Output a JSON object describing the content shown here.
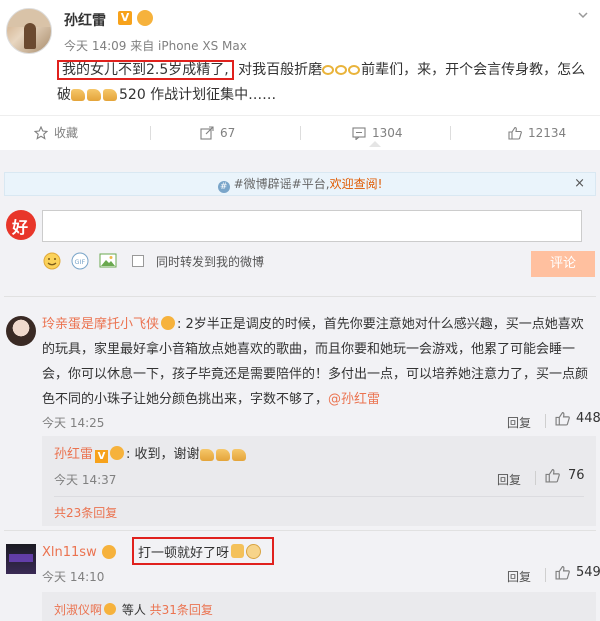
{
  "post": {
    "author": "孙红雷",
    "badge": "V",
    "meta": "今天 14:09 来自 iPhone XS Max",
    "text_highlight": "我的女儿不到2.5岁成精了,",
    "text_part2": " 对我百般折磨",
    "text_part3": "前辈们，来，开个会言传身教，怎么破",
    "text_part4": "520 作战计划征集中……"
  },
  "actions": {
    "collect": "收藏",
    "forward": "67",
    "comment": "1304",
    "like": "12134"
  },
  "notice": {
    "prefix": "#微博辟谣#平台,",
    "highlight": "欢迎查阅!",
    "close": "×"
  },
  "composer": {
    "avatar_letter": "好",
    "input_value": "",
    "share_label": "同时转发到我的微博",
    "submit_label": "评论"
  },
  "comments": [
    {
      "name": "玲亲蛋是摩托小飞侠",
      "text": ": 2岁半正是调皮的时候，首先你要注意她对什么感兴趣，买一点她喜欢的玩具，家里最好拿小音箱放点她喜欢的歌曲，而且你要和她玩一会游戏，他累了可能会睡一会，你可以休息一下，孩子毕竟还是需要陪伴的！多付出一点，可以培养她注意力了，买一点颜色不同的小珠子让她分颜色挑出来，字数不够了，",
      "mention": "@孙红雷",
      "time": "今天 14:25",
      "reply_label": "回复",
      "likes": "448",
      "sub_reply": {
        "name": "孙红雷",
        "text": ": 收到，谢谢",
        "time": "今天 14:37",
        "reply_label": "回复",
        "likes": "76"
      },
      "more_replies": "共23条回复"
    },
    {
      "name": "Xln11sw",
      "text": "打一顿就好了呀",
      "time": "今天 14:10",
      "reply_label": "回复",
      "likes": "549",
      "sub_preview_name": "刘淑仪啊",
      "sub_preview_suffix": " 等人 ",
      "more_replies": "共31条回复"
    }
  ]
}
